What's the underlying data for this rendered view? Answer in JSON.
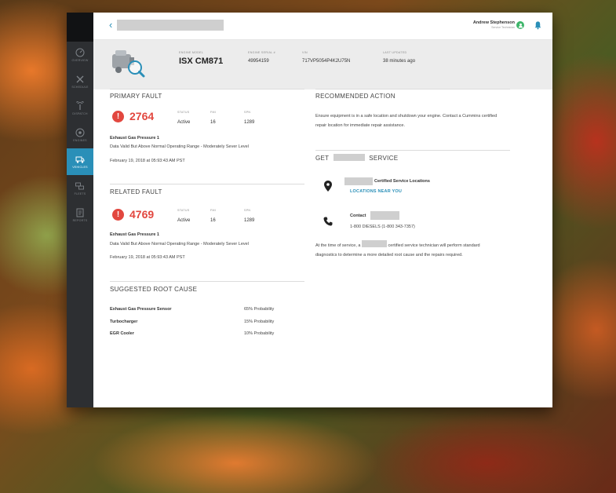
{
  "header": {
    "user_name": "Andrew Stephenson",
    "user_role": "Service Technician"
  },
  "sidebar": {
    "items": [
      {
        "label": "OVERVIEW"
      },
      {
        "label": "SCHEDULE"
      },
      {
        "label": "DISPATCH"
      },
      {
        "label": "ENGINES"
      },
      {
        "label": "VEHICLES"
      },
      {
        "label": "FLEETS"
      },
      {
        "label": "REPORTS"
      }
    ]
  },
  "engine": {
    "model_label": "ENGINE MODEL",
    "model": "ISX CM871",
    "serial_label": "ENGINE SERIAL #",
    "serial": "49954159",
    "vin_label": "VIN",
    "vin": "717VP5054P4K2U75N",
    "updated_label": "LAST UPDATED",
    "updated": "38 minutes ago"
  },
  "primary_fault": {
    "section_title": "PRIMARY FAULT",
    "code": "2764",
    "status_label": "STATUS",
    "status": "Active",
    "fmi_label": "FMI",
    "fmi": "16",
    "spn_label": "SPN",
    "spn": "1289",
    "name": "Exhaust Gas Pressure 1",
    "description": "Data Valid But Above Normal Operating Range - Moderately Sever Level",
    "timestamp": "February 19, 2018 at 05:93:43 AM PST"
  },
  "related_fault": {
    "section_title": "RELATED FAULT",
    "code": "4769",
    "status_label": "STATUS",
    "status": "Active",
    "fmi_label": "FMI",
    "fmi": "16",
    "spn_label": "SPN",
    "spn": "1289",
    "name": "Exhaust Gas Pressure 1",
    "description": "Data Valid But Above Normal Operating Range - Moderately Sever Level",
    "timestamp": "February 19, 2018 at 05:93:43 AM PST"
  },
  "root_cause": {
    "section_title": "SUGGESTED ROOT CAUSE",
    "items": [
      {
        "name": "Exhaust Gas Pressure Sensor",
        "probability": "65% Probability"
      },
      {
        "name": "Turbocharger",
        "probability": "15% Probability"
      },
      {
        "name": "EGR Cooler",
        "probability": "10% Probability"
      }
    ]
  },
  "recommended": {
    "section_title": "RECOMMENDED ACTION",
    "text": "Ensure equipment is in a safe location and shutdown your engine. Contact a Cummins certified repair location for immediate repair assistance."
  },
  "service": {
    "title_prefix": "GET",
    "title_suffix": "SERVICE",
    "locations_label": "Certified Service Locations",
    "locations_link": "LOCATIONS NEAR YOU",
    "contact_label": "Contact",
    "phone": "1-800 DIESELS (1-800 343-7357)",
    "note_prefix": "At the time of service, a",
    "note_suffix": "certified service technician will perform standard diagnostics to determine a more detailed root cause and the repairs required."
  },
  "colors": {
    "accent": "#2a8fb8",
    "fault": "#e2473f",
    "sidebar": "#2d2f32"
  }
}
